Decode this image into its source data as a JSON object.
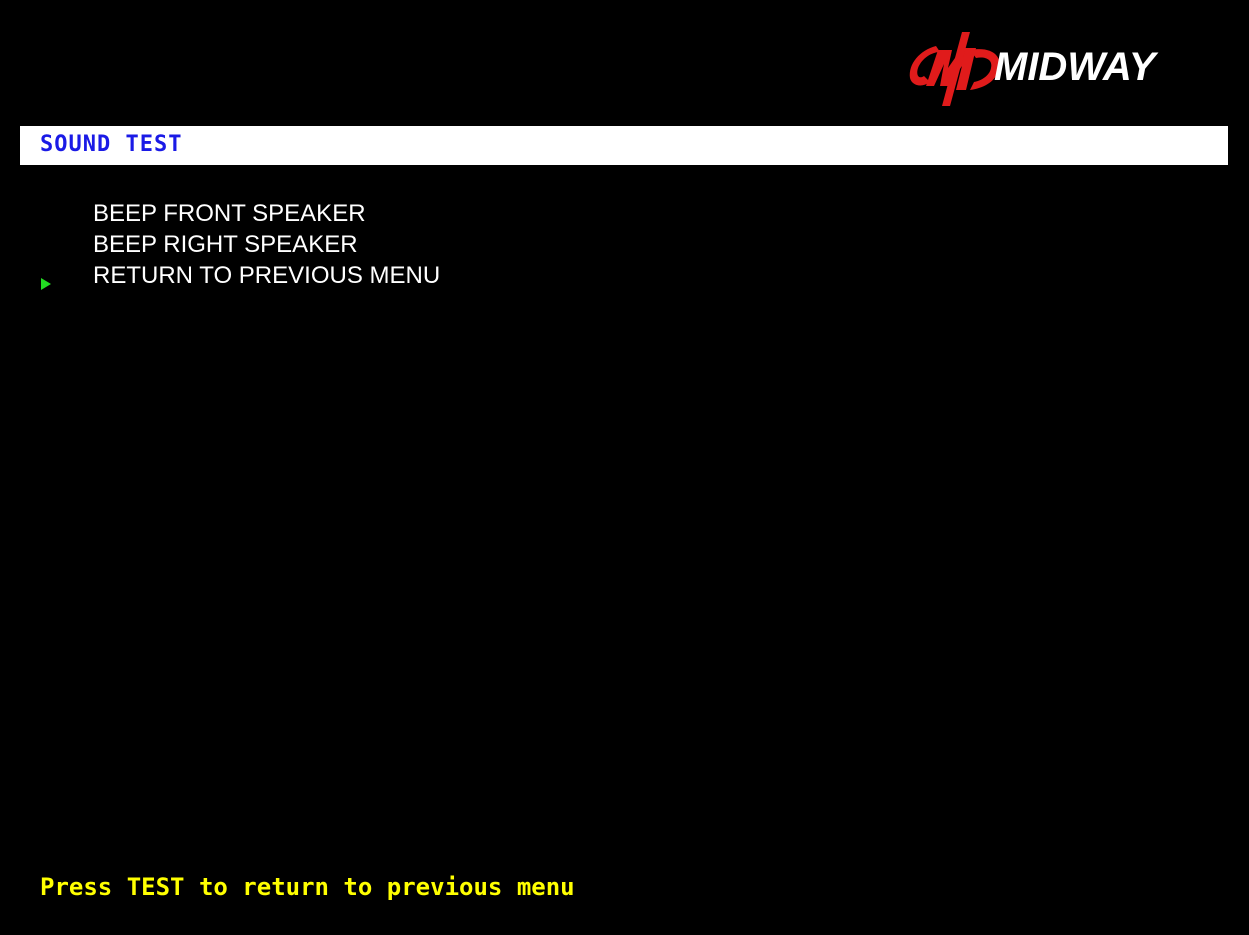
{
  "header": {
    "logo_text": "MIDWAY",
    "logo_icon": "midway-logo-icon"
  },
  "screen": {
    "title": "SOUND TEST"
  },
  "menu": {
    "items": [
      {
        "label": "BEEP FRONT SPEAKER"
      },
      {
        "label": "BEEP RIGHT SPEAKER"
      },
      {
        "label": "RETURN TO PREVIOUS MENU"
      }
    ],
    "selected_index": 2,
    "cursor_icon": "selection-arrow-icon"
  },
  "footer": {
    "hint": "Press TEST to return to previous menu"
  },
  "colors": {
    "background": "#000000",
    "title_bar": "#ffffff",
    "title_text": "#1a1ae6",
    "menu_text": "#ffffff",
    "cursor": "#22dd22",
    "footer_text": "#ffff00",
    "logo_red": "#e01b1b"
  }
}
